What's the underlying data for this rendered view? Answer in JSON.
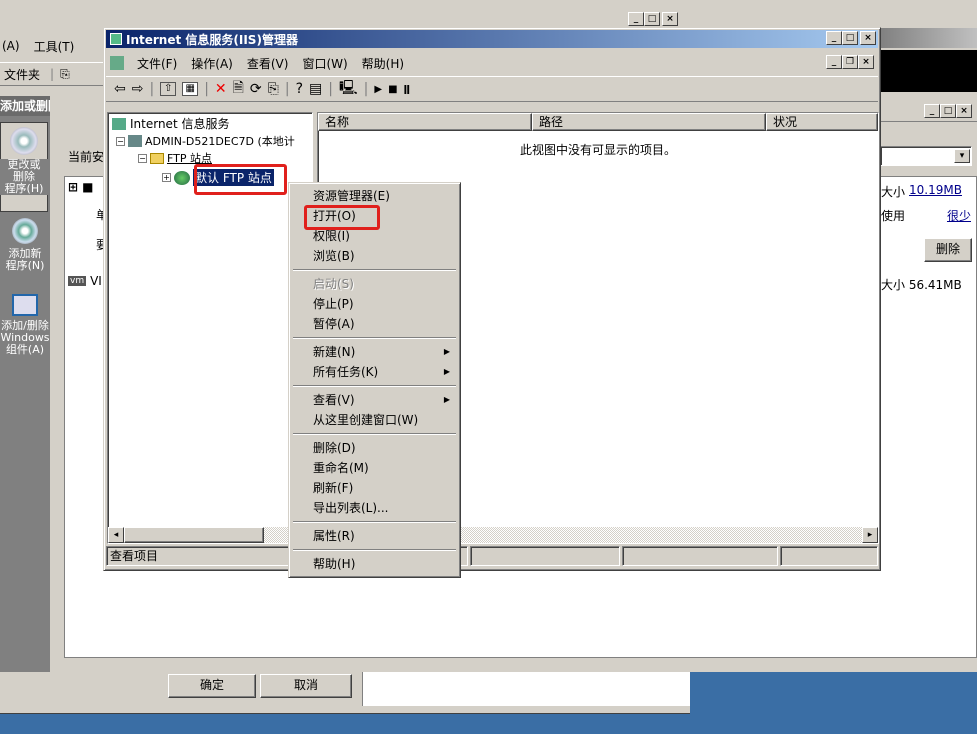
{
  "bg_window": {
    "menu": [
      "(A)",
      "工具(T)"
    ],
    "toolbar_folder": "文件夹",
    "left_header": "添加或删除程序",
    "left_items": [
      {
        "label": "更改或\n删除\n程序(H)",
        "icon": "cd-icon"
      },
      {
        "label": "添加新\n程序(N)",
        "icon": "cd-plus-icon"
      },
      {
        "label": "添加/删除\nWindows\n组件(A)",
        "icon": "windows-components-icon"
      }
    ],
    "current_label": "当前安",
    "row1_bold": "■",
    "row1_sub1": "单",
    "row1_sub2": "要",
    "row2_prefix": "VI",
    "right_size1_label": "大小",
    "right_size1_value": "10.19MB",
    "right_use_label": "使用",
    "right_use_value": "很少",
    "right_delete_button": "删除",
    "right_size2": "大小 56.41MB",
    "ok_button": "确定",
    "cancel_button": "取消"
  },
  "iis": {
    "title": "Internet 信息服务(IIS)管理器",
    "menu": [
      "文件(F)",
      "操作(A)",
      "查看(V)",
      "窗口(W)",
      "帮助(H)"
    ],
    "tree": {
      "root": "Internet 信息服务",
      "server": "ADMIN-D521DEC7D (本地计",
      "ftp_sites": "FTP 站点",
      "default_ftp": "默认 FTP 站点"
    },
    "columns": [
      "名称",
      "路径",
      "状况"
    ],
    "empty_message": "此视图中没有可显示的项目。",
    "status": "查看项目"
  },
  "context_menu": {
    "items": [
      {
        "label": "资源管理器(E)",
        "type": "item"
      },
      {
        "label": "打开(O)",
        "type": "item",
        "highlight": true
      },
      {
        "label": "权限(I)",
        "type": "item"
      },
      {
        "label": "浏览(B)",
        "type": "item"
      },
      {
        "type": "sep"
      },
      {
        "label": "启动(S)",
        "type": "disabled"
      },
      {
        "label": "停止(P)",
        "type": "item"
      },
      {
        "label": "暂停(A)",
        "type": "item"
      },
      {
        "type": "sep"
      },
      {
        "label": "新建(N)",
        "type": "submenu"
      },
      {
        "label": "所有任务(K)",
        "type": "submenu"
      },
      {
        "type": "sep"
      },
      {
        "label": "查看(V)",
        "type": "submenu"
      },
      {
        "label": "从这里创建窗口(W)",
        "type": "item"
      },
      {
        "type": "sep"
      },
      {
        "label": "删除(D)",
        "type": "item"
      },
      {
        "label": "重命名(M)",
        "type": "item"
      },
      {
        "label": "刷新(F)",
        "type": "item"
      },
      {
        "label": "导出列表(L)...",
        "type": "item"
      },
      {
        "type": "sep"
      },
      {
        "label": "属性(R)",
        "type": "item"
      },
      {
        "type": "sep"
      },
      {
        "label": "帮助(H)",
        "type": "item"
      }
    ]
  },
  "colors": {
    "desktop": "#3a6ea5",
    "title_active": "#0a246a",
    "highlight_box": "#e0201c"
  }
}
